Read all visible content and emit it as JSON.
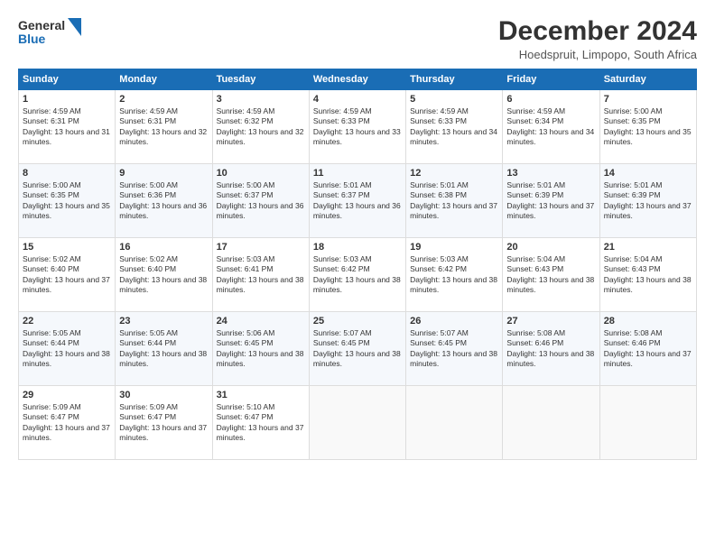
{
  "logo": {
    "line1": "General",
    "line2": "Blue"
  },
  "title": "December 2024",
  "location": "Hoedspruit, Limpopo, South Africa",
  "days_header": [
    "Sunday",
    "Monday",
    "Tuesday",
    "Wednesday",
    "Thursday",
    "Friday",
    "Saturday"
  ],
  "weeks": [
    [
      {
        "day": "1",
        "rise": "4:59 AM",
        "set": "6:31 PM",
        "hours": "13 hours and 31 minutes."
      },
      {
        "day": "2",
        "rise": "4:59 AM",
        "set": "6:31 PM",
        "hours": "13 hours and 32 minutes."
      },
      {
        "day": "3",
        "rise": "4:59 AM",
        "set": "6:32 PM",
        "hours": "13 hours and 32 minutes."
      },
      {
        "day": "4",
        "rise": "4:59 AM",
        "set": "6:33 PM",
        "hours": "13 hours and 33 minutes."
      },
      {
        "day": "5",
        "rise": "4:59 AM",
        "set": "6:33 PM",
        "hours": "13 hours and 34 minutes."
      },
      {
        "day": "6",
        "rise": "4:59 AM",
        "set": "6:34 PM",
        "hours": "13 hours and 34 minutes."
      },
      {
        "day": "7",
        "rise": "5:00 AM",
        "set": "6:35 PM",
        "hours": "13 hours and 35 minutes."
      }
    ],
    [
      {
        "day": "8",
        "rise": "5:00 AM",
        "set": "6:35 PM",
        "hours": "13 hours and 35 minutes."
      },
      {
        "day": "9",
        "rise": "5:00 AM",
        "set": "6:36 PM",
        "hours": "13 hours and 36 minutes."
      },
      {
        "day": "10",
        "rise": "5:00 AM",
        "set": "6:37 PM",
        "hours": "13 hours and 36 minutes."
      },
      {
        "day": "11",
        "rise": "5:01 AM",
        "set": "6:37 PM",
        "hours": "13 hours and 36 minutes."
      },
      {
        "day": "12",
        "rise": "5:01 AM",
        "set": "6:38 PM",
        "hours": "13 hours and 37 minutes."
      },
      {
        "day": "13",
        "rise": "5:01 AM",
        "set": "6:39 PM",
        "hours": "13 hours and 37 minutes."
      },
      {
        "day": "14",
        "rise": "5:01 AM",
        "set": "6:39 PM",
        "hours": "13 hours and 37 minutes."
      }
    ],
    [
      {
        "day": "15",
        "rise": "5:02 AM",
        "set": "6:40 PM",
        "hours": "13 hours and 37 minutes."
      },
      {
        "day": "16",
        "rise": "5:02 AM",
        "set": "6:40 PM",
        "hours": "13 hours and 38 minutes."
      },
      {
        "day": "17",
        "rise": "5:03 AM",
        "set": "6:41 PM",
        "hours": "13 hours and 38 minutes."
      },
      {
        "day": "18",
        "rise": "5:03 AM",
        "set": "6:42 PM",
        "hours": "13 hours and 38 minutes."
      },
      {
        "day": "19",
        "rise": "5:03 AM",
        "set": "6:42 PM",
        "hours": "13 hours and 38 minutes."
      },
      {
        "day": "20",
        "rise": "5:04 AM",
        "set": "6:43 PM",
        "hours": "13 hours and 38 minutes."
      },
      {
        "day": "21",
        "rise": "5:04 AM",
        "set": "6:43 PM",
        "hours": "13 hours and 38 minutes."
      }
    ],
    [
      {
        "day": "22",
        "rise": "5:05 AM",
        "set": "6:44 PM",
        "hours": "13 hours and 38 minutes."
      },
      {
        "day": "23",
        "rise": "5:05 AM",
        "set": "6:44 PM",
        "hours": "13 hours and 38 minutes."
      },
      {
        "day": "24",
        "rise": "5:06 AM",
        "set": "6:45 PM",
        "hours": "13 hours and 38 minutes."
      },
      {
        "day": "25",
        "rise": "5:07 AM",
        "set": "6:45 PM",
        "hours": "13 hours and 38 minutes."
      },
      {
        "day": "26",
        "rise": "5:07 AM",
        "set": "6:45 PM",
        "hours": "13 hours and 38 minutes."
      },
      {
        "day": "27",
        "rise": "5:08 AM",
        "set": "6:46 PM",
        "hours": "13 hours and 38 minutes."
      },
      {
        "day": "28",
        "rise": "5:08 AM",
        "set": "6:46 PM",
        "hours": "13 hours and 37 minutes."
      }
    ],
    [
      {
        "day": "29",
        "rise": "5:09 AM",
        "set": "6:47 PM",
        "hours": "13 hours and 37 minutes."
      },
      {
        "day": "30",
        "rise": "5:09 AM",
        "set": "6:47 PM",
        "hours": "13 hours and 37 minutes."
      },
      {
        "day": "31",
        "rise": "5:10 AM",
        "set": "6:47 PM",
        "hours": "13 hours and 37 minutes."
      },
      null,
      null,
      null,
      null
    ]
  ]
}
